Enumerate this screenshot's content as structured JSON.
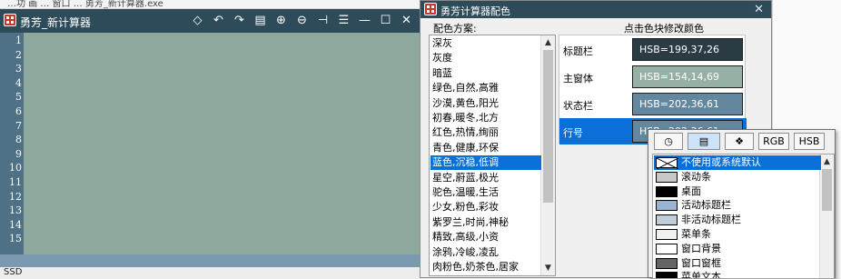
{
  "background_strip": {
    "text": "…功 画 … 窗口 … 勇芳_新计算器.exe"
  },
  "calculator": {
    "title": "勇芳_新计算器",
    "toolbar_icons": [
      "eraser-icon",
      "undo-icon",
      "redo-icon",
      "keyboard-icon",
      "zoom-in-icon",
      "zoom-out-icon",
      "pin-icon",
      "menu-icon",
      "minimize-icon",
      "maximize-icon",
      "close-icon"
    ],
    "toolbar_glyphs": [
      "◇",
      "↶",
      "↷",
      "▤",
      "⊕",
      "⊖",
      "⊣",
      "☰",
      "—",
      "☐",
      "✕"
    ],
    "line_numbers": [
      "1",
      "2",
      "3",
      "4",
      "5",
      "6",
      "7",
      "8",
      "9",
      "10",
      "11",
      "12",
      "13",
      "14",
      "15"
    ],
    "status_left": "SSD"
  },
  "dialog": {
    "title": "勇芳计算器配色",
    "close_glyph": "✕",
    "scheme_label": "配色方案:",
    "hint": "点击色块修改颜色",
    "schemes": [
      "深灰",
      "灰度",
      "暗蓝",
      "绿色,自然,高雅",
      "沙漠,黄色,阳光",
      "初春,暖冬,北方",
      "红色,热情,绚丽",
      "青色,健康,环保",
      "蓝色,沉稳,低调",
      "星空,蔚蓝,极光",
      "驼色,温暖,生活",
      "少女,粉色,彩妆",
      "紫罗兰,时尚,神秘",
      "精致,高级,小资",
      "涂鸦,冷峻,凌乱",
      "肉粉色,奶茶色,居家"
    ],
    "selected_scheme_index": 8,
    "scroll_up_glyph": "▲",
    "scroll_down_glyph": "▼",
    "color_rows": [
      {
        "label": "标题栏",
        "value": "HSB=199,37,26",
        "color": "#2a3b43"
      },
      {
        "label": "主窗体",
        "value": "HSB=154,14,69",
        "color": "#97b0a5"
      },
      {
        "label": "状态栏",
        "value": "HSB=202,36,61",
        "color": "#6487a0"
      },
      {
        "label": "行号",
        "value": "HSB=202,36,61",
        "color": "#6487a0"
      }
    ],
    "selected_row_index": 3
  },
  "picker": {
    "tabs": [
      {
        "label": "◷",
        "icon": "clock-icon"
      },
      {
        "label": "▤",
        "icon": "palette-grid-icon"
      },
      {
        "label": "❖",
        "icon": "diamond-icon"
      },
      {
        "label": "RGB",
        "icon": ""
      },
      {
        "label": "HSB",
        "icon": ""
      }
    ],
    "active_tab_index": 1,
    "items": [
      {
        "label": "不使用或系统默认",
        "color": "#ffffff"
      },
      {
        "label": "滚动条",
        "color": "#c8c8c8"
      },
      {
        "label": "桌面",
        "color": "#000000"
      },
      {
        "label": "活动标题栏",
        "color": "#99b4d1"
      },
      {
        "label": "非活动标题栏",
        "color": "#bfcddb"
      },
      {
        "label": "菜单条",
        "color": "#f0f0f0"
      },
      {
        "label": "窗口背景",
        "color": "#ffffff"
      },
      {
        "label": "窗口窗框",
        "color": "#646464"
      },
      {
        "label": "菜单文本",
        "color": "#000000"
      }
    ],
    "selected_item_index": 0,
    "scroll_up_glyph": "▲"
  },
  "colors": {
    "calc_title_bg": "#2e4b5a",
    "calc_body_bg": "#8ea89e",
    "gutter_bg": "#4f7186",
    "selection_blue": "#0a6fd8"
  }
}
